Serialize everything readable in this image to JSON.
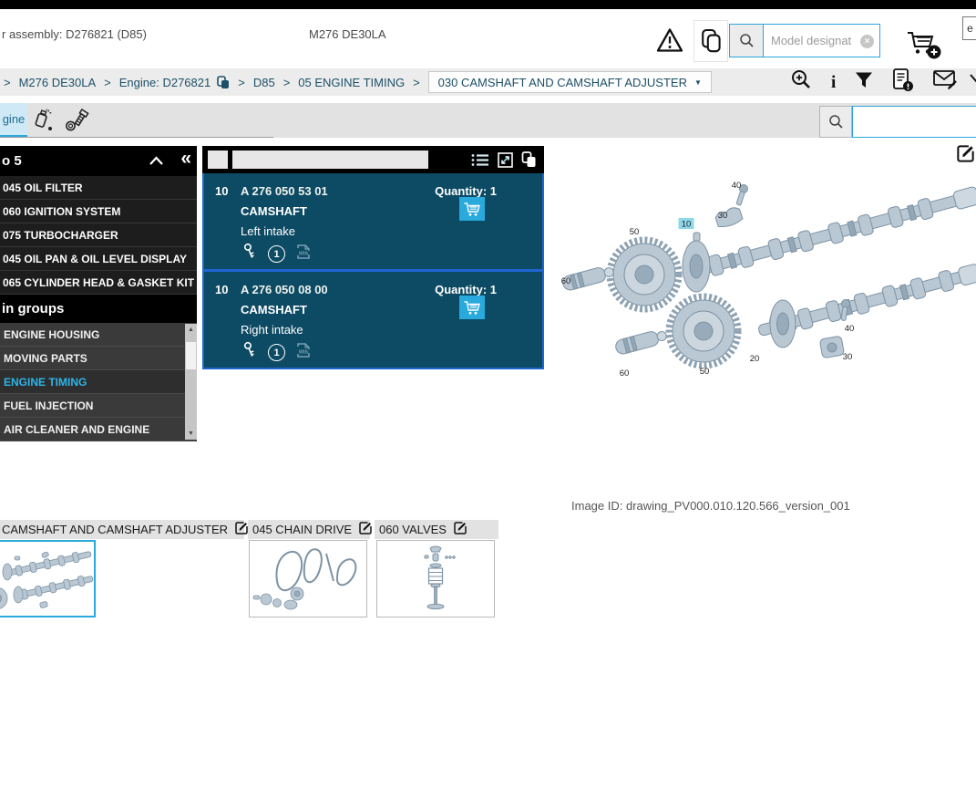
{
  "colors": {
    "accent": "#29a9dc",
    "panel_bg": "#0d4a63",
    "panel_divider": "#1f65d4",
    "selected_item_text": "#2cb5ea",
    "callout_highlight_bg": "#8fd8ea"
  },
  "header": {
    "assembly": "r assembly: D276821 (D85)",
    "model": "M276 DE30LA",
    "corner_letter": "e",
    "search_placeholder": "Model designat"
  },
  "breadcrumb": {
    "sep": ">",
    "crumbs": [
      "M276 DE30LA",
      "Engine: D276821",
      "D85",
      "05 ENGINE TIMING"
    ],
    "dropdown_label": "030 CAMSHAFT AND CAMSHAFT ADJUSTER",
    "caret": "▼"
  },
  "tab_bar": {
    "active_tab": "gine"
  },
  "sidebar": {
    "top_header": "o 5",
    "collapse_icon": "«",
    "top_items": [
      "045 OIL FILTER",
      "060 IGNITION SYSTEM",
      "075 TURBOCHARGER",
      "045 OIL PAN & OIL LEVEL DISPLAY",
      "065 CYLINDER HEAD & GASKET KIT"
    ],
    "groups_header": "in groups",
    "group_items": [
      "ENGINE HOUSING",
      "MOVING PARTS",
      "ENGINE TIMING",
      "FUEL INJECTION",
      "AIR CLEANER AND ENGINE"
    ],
    "selected_group": "ENGINE TIMING",
    "scroll_up": "▲",
    "scroll_down": "▼"
  },
  "parts_panel": {
    "rows": [
      {
        "pos": "10",
        "number": "A 276 050 53 01",
        "name": "CAMSHAFT",
        "variant": "Left intake",
        "quantity": "Quantity: 1",
        "circle_badge": "1",
        "wis": "WIS"
      },
      {
        "pos": "10",
        "number": "A 276 050 08 00",
        "name": "CAMSHAFT",
        "variant": "Right intake",
        "quantity": "Quantity: 1",
        "circle_badge": "1",
        "wis": "WIS"
      }
    ]
  },
  "diagram": {
    "image_id": "Image ID: drawing_PV000.010.120.566_version_001",
    "callouts": [
      "40",
      "30",
      "10",
      "50",
      "60",
      "20",
      "50",
      "60",
      "40",
      "30"
    ],
    "highlighted_callout": "10"
  },
  "thumbnails": [
    {
      "title": "CAMSHAFT AND CAMSHAFT ADJUSTER"
    },
    {
      "title": "045 CHAIN DRIVE"
    },
    {
      "title": "060 VALVES"
    }
  ]
}
